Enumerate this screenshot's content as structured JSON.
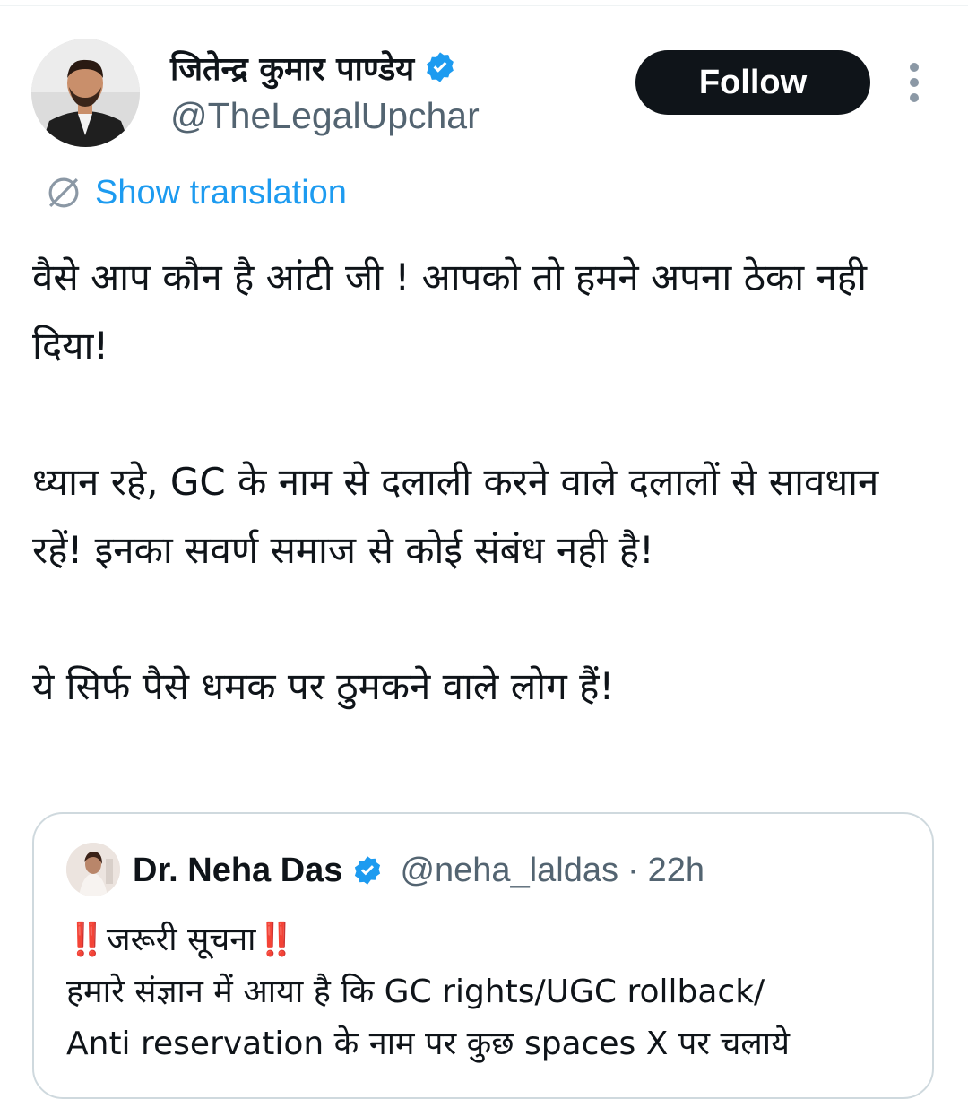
{
  "tweet": {
    "author": {
      "name": "जितेन्द्र कुमार पाण्डेय",
      "handle": "@TheLegalUpchar",
      "verified_icon": "verified-badge-icon"
    },
    "follow_label": "Follow",
    "more_icon": "more-options-icon",
    "translation_label": "Show translation",
    "body": {
      "para1": "वैसे आप कौन है आंटी जी !  आपको तो हमने अपना ठेका नही दिया!",
      "para2": "ध्यान रहे, GC के नाम से दलाली करने वाले दलालों से सावधान रहें! इनका सवर्ण समाज से कोई संबंध नही है!",
      "para3": "ये सिर्फ पैसे धमक पर ठुमकने वाले लोग हैं!"
    },
    "quote": {
      "name": "Dr. Neha Das",
      "handle": "@neha_laldas",
      "separator": "·",
      "time": "22h",
      "alert_mark": "‼️",
      "headline": "जरूरी सूचना",
      "line2": "हमारे संज्ञान में आया है कि GC rights/UGC  rollback/",
      "line3": "Anti reservation के नाम पर कुछ spaces X पर चलाये"
    }
  },
  "colors": {
    "accent": "#1d9bf0",
    "text": "#0f1419",
    "muted": "#536471",
    "follow_bg": "#0f1419",
    "border": "#cfd9de"
  }
}
